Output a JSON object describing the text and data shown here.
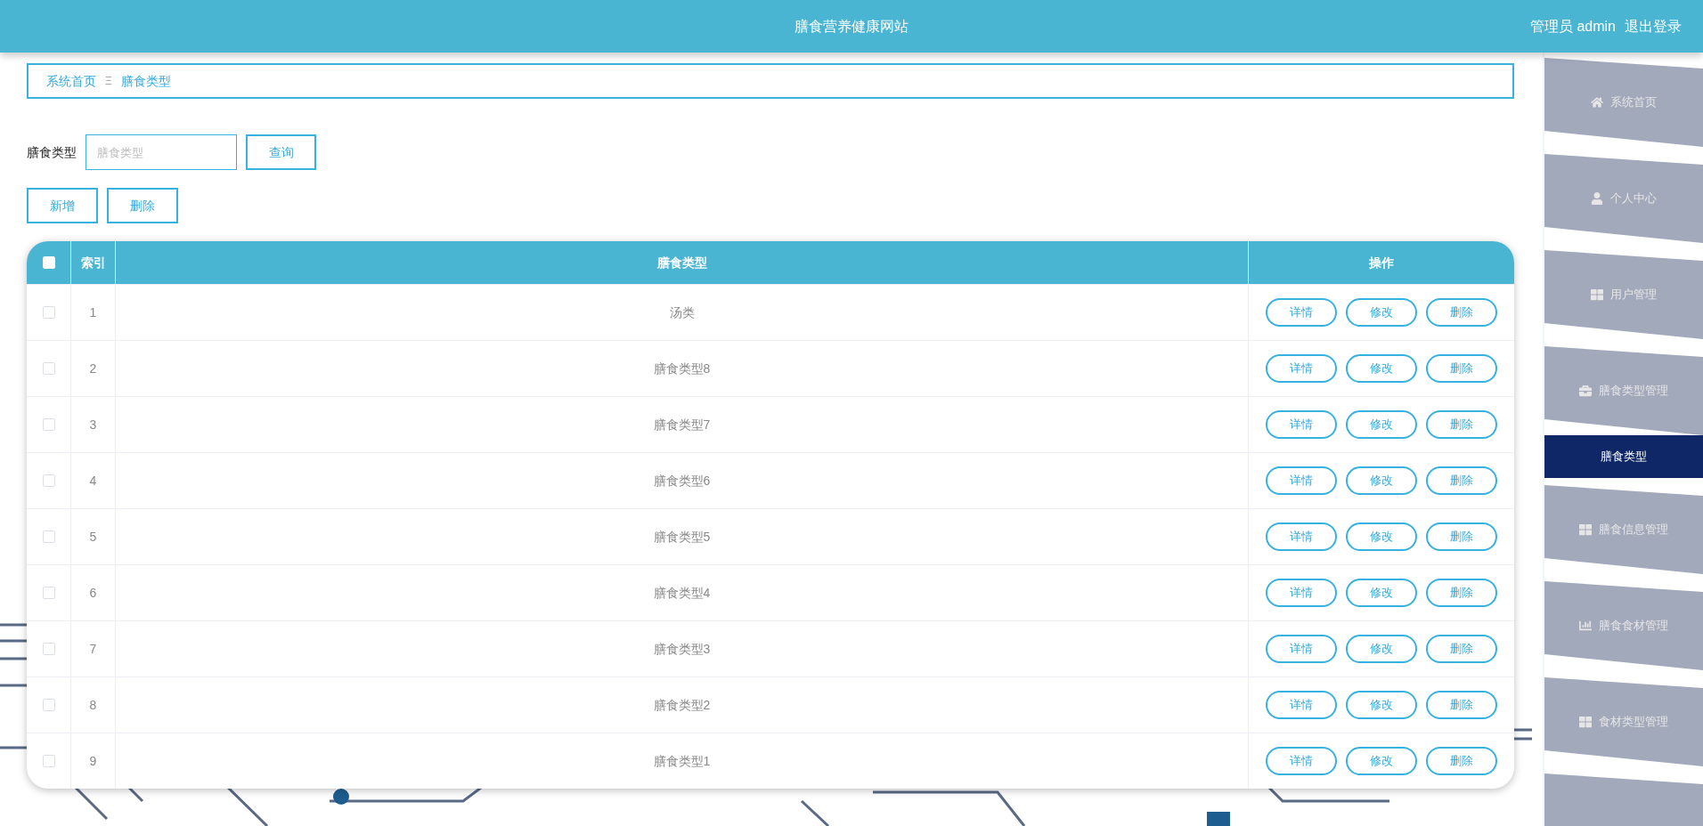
{
  "header": {
    "title": "膳食营养健康网站",
    "user": "管理员 admin",
    "logout": "退出登录"
  },
  "breadcrumb": [
    {
      "label": "系统首页"
    },
    {
      "label": "膳食类型"
    }
  ],
  "breadcrumb_separator": "Ξ",
  "search": {
    "label": "膳食类型",
    "placeholder": "膳食类型",
    "button": "查询"
  },
  "actions": [
    "新增",
    "删除"
  ],
  "table": {
    "select_all_checked": false,
    "columns": [
      "索引",
      "膳食类型",
      "操作"
    ],
    "rows": [
      {
        "checked": false,
        "index": "1",
        "name": "汤类",
        "actions": [
          "详情",
          "修改",
          "删除"
        ]
      },
      {
        "checked": false,
        "index": "2",
        "name": "膳食类型8",
        "actions": [
          "详情",
          "修改",
          "删除"
        ]
      },
      {
        "checked": false,
        "index": "3",
        "name": "膳食类型7",
        "actions": [
          "详情",
          "修改",
          "删除"
        ]
      },
      {
        "checked": false,
        "index": "4",
        "name": "膳食类型6",
        "actions": [
          "详情",
          "修改",
          "删除"
        ]
      },
      {
        "checked": false,
        "index": "5",
        "name": "膳食类型5",
        "actions": [
          "详情",
          "修改",
          "删除"
        ]
      },
      {
        "checked": false,
        "index": "6",
        "name": "膳食类型4",
        "actions": [
          "详情",
          "修改",
          "删除"
        ]
      },
      {
        "checked": false,
        "index": "7",
        "name": "膳食类型3",
        "actions": [
          "详情",
          "修改",
          "删除"
        ]
      },
      {
        "checked": false,
        "index": "8",
        "name": "膳食类型2",
        "actions": [
          "详情",
          "修改",
          "删除"
        ]
      },
      {
        "checked": false,
        "index": "9",
        "name": "膳食类型1",
        "actions": [
          "详情",
          "修改",
          "删除"
        ]
      }
    ]
  },
  "sidebar": {
    "items": [
      {
        "label": "系统首页",
        "expanded": false
      },
      {
        "label": "个人中心",
        "expanded": false
      },
      {
        "label": "用户管理",
        "expanded": false
      },
      {
        "label": "膳食类型管理",
        "expanded": true,
        "children": [
          {
            "label": "膳食类型",
            "selected": true
          }
        ]
      },
      {
        "label": "膳食信息管理",
        "expanded": false
      },
      {
        "label": "膳食食材管理",
        "expanded": false
      },
      {
        "label": "食材类型管理",
        "expanded": false
      }
    ]
  }
}
